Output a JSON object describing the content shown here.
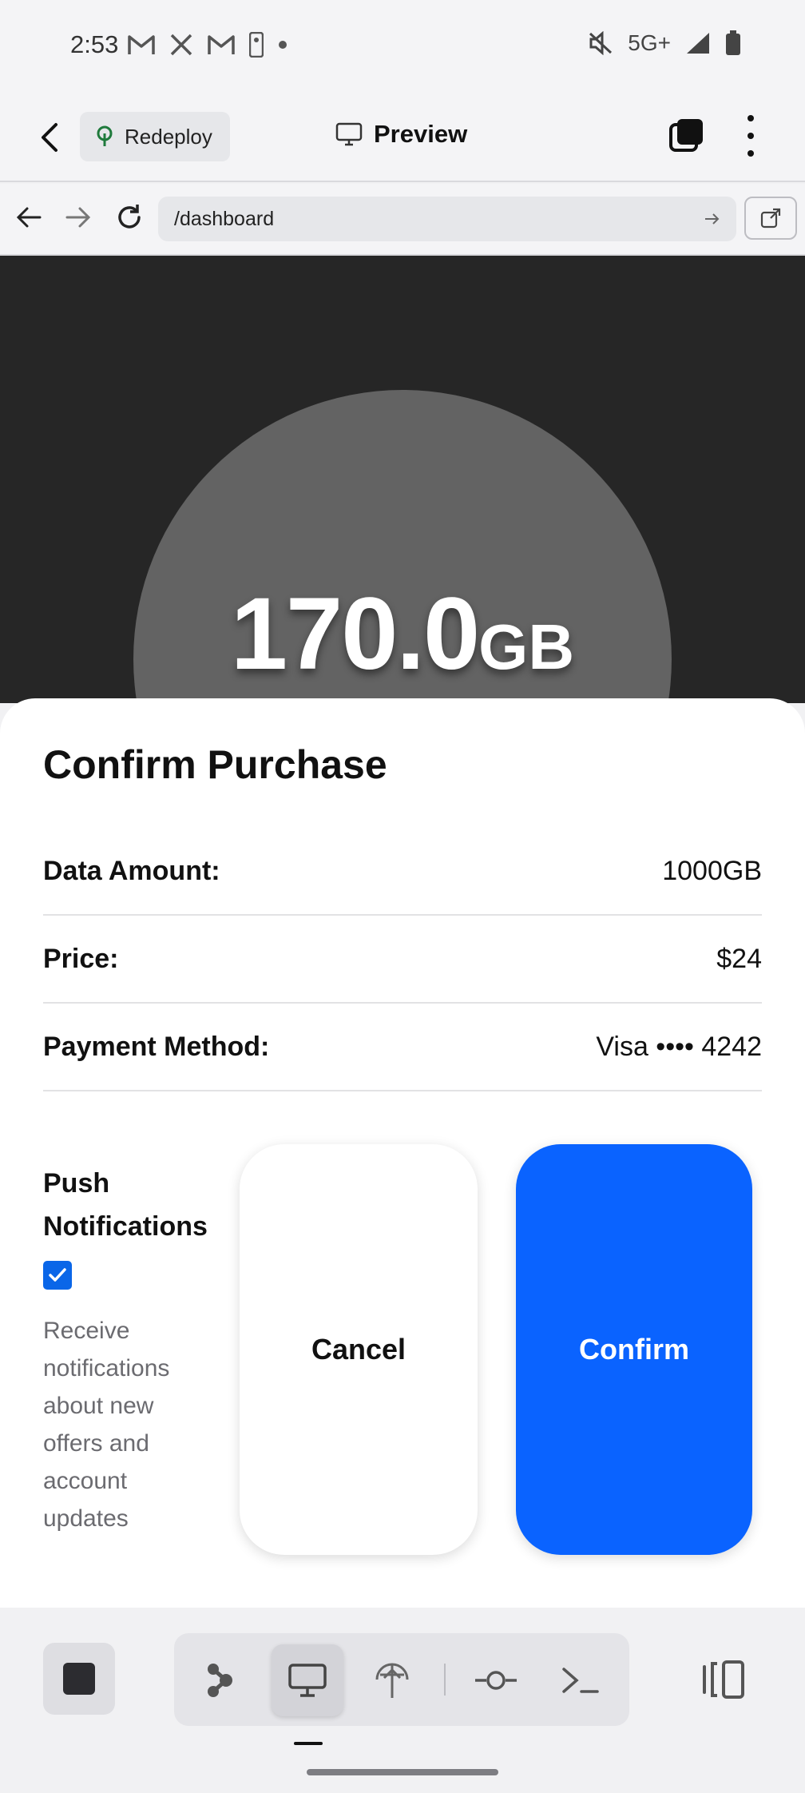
{
  "status_bar": {
    "time": "2:53",
    "network": "5G+",
    "left_icons": [
      "gmail-icon",
      "x-icon",
      "gmail-icon",
      "nba-icon",
      "dot-icon"
    ],
    "right_icons": [
      "mute-icon",
      "signal-icon",
      "battery-icon"
    ]
  },
  "header": {
    "redeploy_label": "Redeploy",
    "preview_label": "Preview"
  },
  "browser": {
    "url": "/dashboard"
  },
  "dashboard": {
    "gauge_value": "170.0",
    "gauge_unit": "GB"
  },
  "sheet": {
    "title": "Confirm Purchase",
    "rows": [
      {
        "label": "Data Amount:",
        "value": "1000GB"
      },
      {
        "label": "Price:",
        "value": "$24"
      },
      {
        "label": "Payment Method:",
        "value": "Visa •••• 4242"
      }
    ],
    "notifications": {
      "title": "Push Notifications",
      "checked": true,
      "description": "Receive notifications about new offers and account updates"
    },
    "cancel_label": "Cancel",
    "confirm_label": "Confirm"
  },
  "colors": {
    "accent": "#0a63ff",
    "dashboard_bg": "#262626",
    "gauge": "#636363"
  }
}
